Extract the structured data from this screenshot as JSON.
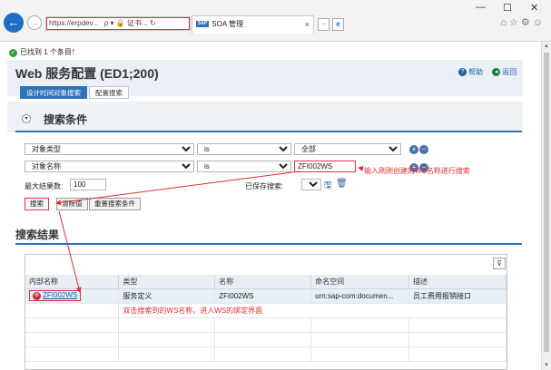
{
  "browser": {
    "url": "https://erpdev...",
    "addr_extra": "ρ ▾ 🔒 证书... ↻",
    "tab_badge": "SAP",
    "tab_title": "SOA 管理",
    "tab_close": "×"
  },
  "found_msg": "已找到 1 个条目！",
  "page_title": "Web 服务配置 (ED1;200)",
  "header_links": {
    "help": "帮助",
    "back": "返回"
  },
  "tabs": [
    "设计时间对象搜索",
    "配置搜索"
  ],
  "criteria": {
    "title": "搜索条件",
    "row1": {
      "field": "对象类型",
      "op": "is",
      "value": "全部"
    },
    "row2": {
      "field": "对象名称",
      "op": "is",
      "value": "ZFI002WS"
    },
    "max_label": "最大结果数:",
    "max_value": "100",
    "saved_label": "已保存搜索:",
    "search_btn": "搜索",
    "clear_btn": "清除值",
    "reset_btn": "重置搜索条件"
  },
  "annotations": {
    "input_hint": "输入刚刚创建的WS名称进行搜索",
    "dblclick_hint": "双击搜索到的WS名称，进入WS的绑定界面"
  },
  "results": {
    "title": "搜索结果",
    "columns": [
      "内部名称",
      "类型",
      "名称",
      "命名空间",
      "描述"
    ],
    "rows": [
      [
        "ZFI002WS",
        "服务定义",
        "ZFI002WS",
        "urn:sap-com:documen...",
        "员工费用报销接口"
      ]
    ]
  },
  "colors": {
    "accent": "#2f72b8",
    "annotation": "#e03030"
  },
  "icons": [
    "back-arrow-icon",
    "forward-arrow-icon",
    "home-icon",
    "star-icon",
    "gear-icon",
    "smiley-icon",
    "help-icon",
    "back-icon",
    "collapse-icon",
    "filter-icon",
    "save-icon",
    "delete-icon",
    "check-icon"
  ]
}
